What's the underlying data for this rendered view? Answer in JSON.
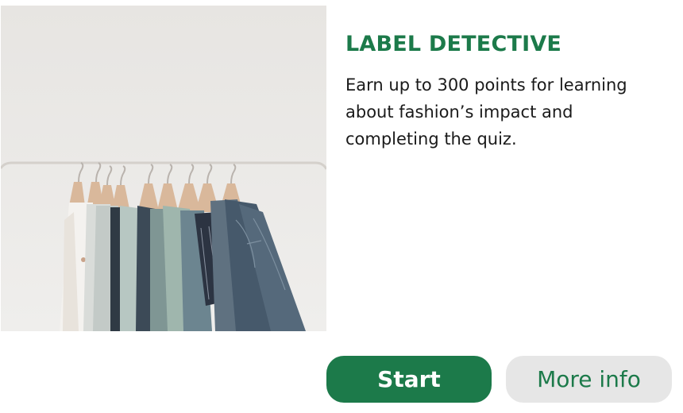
{
  "card": {
    "title": "LABEL DETECTIVE",
    "description": "Earn up to 300 points for learning about fashion’s impact and completing the quiz.",
    "image_subject": "clothing-rack-photo"
  },
  "actions": {
    "start_label": "Start",
    "more_info_label": "More info"
  },
  "colors": {
    "brand_green": "#1c7a4a",
    "secondary_button_bg": "#e6e6e6",
    "text": "#1a1a1a"
  }
}
